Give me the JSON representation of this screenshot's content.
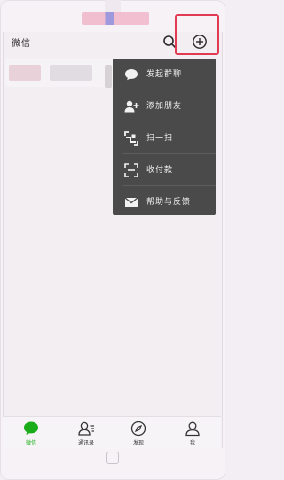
{
  "header": {
    "title": "微信"
  },
  "menu": {
    "items": [
      {
        "label": "发起群聊",
        "icon": "chat-bubble-icon"
      },
      {
        "label": "添加朋友",
        "icon": "add-friend-icon"
      },
      {
        "label": "扫一扫",
        "icon": "scan-icon"
      },
      {
        "label": "收付款",
        "icon": "payment-scan-icon"
      },
      {
        "label": "帮助与反馈",
        "icon": "mail-icon"
      }
    ]
  },
  "tabs": [
    {
      "label": "微信",
      "icon": "chat-bubble-icon",
      "active": true
    },
    {
      "label": "通讯录",
      "icon": "contacts-icon",
      "active": false
    },
    {
      "label": "发现",
      "icon": "compass-icon",
      "active": false
    },
    {
      "label": "我",
      "icon": "person-icon",
      "active": false
    }
  ],
  "colors": {
    "accent": "#1aad19",
    "highlight_box": "#e23a52",
    "menu_bg": "#4a4a4a"
  }
}
